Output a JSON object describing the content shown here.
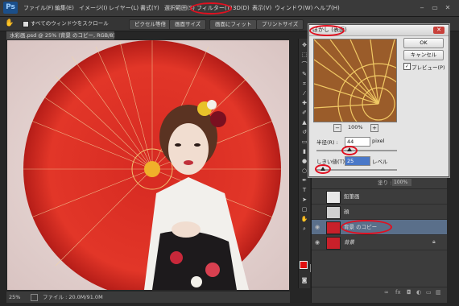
{
  "app": {
    "logo": "Ps"
  },
  "menu": [
    "ファイル(F)",
    "編集(E)",
    "イメージ(I)",
    "レイヤー(L)",
    "書式(Y)",
    "選択範囲(S)",
    "フィルター(T)",
    "3D(D)",
    "表示(V)",
    "ウィンドウ(W)",
    "ヘルプ(H)"
  ],
  "window_controls": [
    "‒",
    "▭",
    "✕"
  ],
  "options_bar": {
    "checkbox_label": "すべてのウィンドウをスクロール",
    "buttons": [
      "ピクセル等倍",
      "画面サイズ",
      "画面にフィット",
      "プリントサイズ"
    ]
  },
  "document": {
    "tab_title": "水彩画.psd @ 25% (背景 のコピー, RGB/8) *"
  },
  "status": {
    "zoom": "25%",
    "file_info": "ファイル : 20.0M/91.0M"
  },
  "dialog": {
    "title": "ぼかし (表面)",
    "ok": "OK",
    "cancel": "キャンセル",
    "preview_label": "プレビュー(P)",
    "preview_checked": "✓",
    "zoom": "100%",
    "zoom_out": "−",
    "zoom_in": "+",
    "radius_label": "半径(R) :",
    "radius_value": "44",
    "radius_unit": "pixel",
    "threshold_label": "しきい値(T) :",
    "threshold_value": "25",
    "threshold_unit": "レベル"
  },
  "layers": {
    "opacity_label": "塗り :",
    "opacity_value": "100%",
    "items": [
      {
        "name": "鉛筆画",
        "visible": false
      },
      {
        "name": "顔",
        "visible": false
      },
      {
        "name": "背景 のコピー",
        "visible": true,
        "selected": true
      },
      {
        "name": "背景",
        "visible": true,
        "locked": true
      }
    ]
  },
  "colors": {
    "accent": "#e01020",
    "selected_layer": "#5a6f8a"
  }
}
